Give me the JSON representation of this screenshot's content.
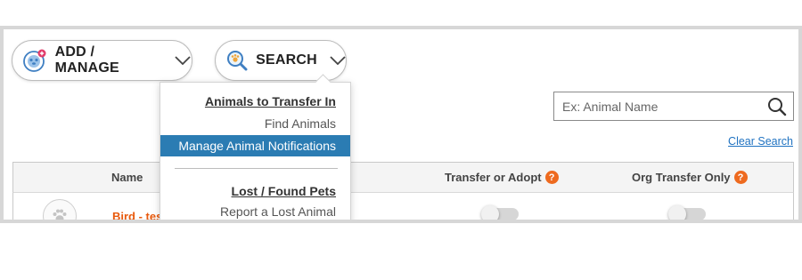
{
  "toolbar": {
    "add_manage": {
      "label": "ADD / MANAGE",
      "icon": "pet-add-icon"
    },
    "search": {
      "label": "SEARCH",
      "icon": "magnifier-paw-icon"
    }
  },
  "search_box": {
    "placeholder": "Ex: Animal Name",
    "value": ""
  },
  "clear_search": "Clear Search",
  "table": {
    "columns": [
      "Name",
      "Transfer or Adopt",
      "Org Transfer Only"
    ],
    "help_mark": "?",
    "rows": [
      {
        "name": "Bird - tes",
        "transfer_or_adopt": false,
        "org_transfer_only": false
      }
    ]
  },
  "dropdown": {
    "section1_heading": "Animals to Transfer In",
    "item_find": "Find Animals",
    "item_manage_notifications": "Manage Animal Notifications",
    "section2_heading": "Lost / Found Pets",
    "item_report_lost": "Report a Lost Animal"
  },
  "colors": {
    "accent_blue": "#2b7cb3",
    "link_blue": "#1f72c1",
    "orange": "#ee6a1f",
    "name_orange": "#e8590c"
  }
}
